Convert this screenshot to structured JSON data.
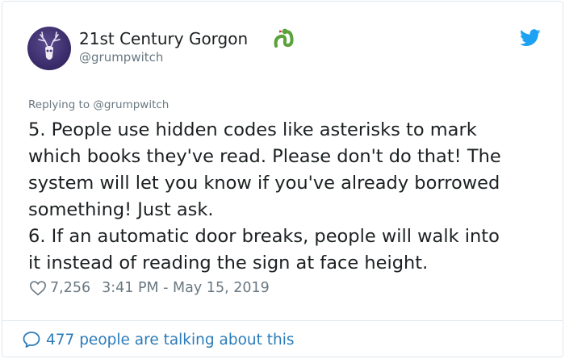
{
  "author": {
    "display_name": "21st Century Gorgon",
    "handle": "@grumpwitch",
    "avatar_icon": "stag-skull-icon",
    "badge_icon": "snake-icon"
  },
  "tweet": {
    "replying_to": "Replying to @grumpwitch",
    "lines": [
      "5. People use hidden codes like asterisks to mark",
      "which books they've read. Please don't do that! The",
      "system will let you know if you've already borrowed",
      "something! Just ask.",
      "6. If an automatic door breaks, people will walk into",
      "it instead of reading the sign at face height."
    ],
    "likes": "7,256",
    "timestamp": "3:41 PM - May 15, 2019"
  },
  "footer": {
    "conversation_text": "477 people are talking about this"
  },
  "colors": {
    "twitter_blue": "#1da1f2",
    "link_blue": "#2b7bb9",
    "muted_text": "#697882",
    "snake_green": "#5aa23a",
    "border": "#e1e8ed"
  }
}
